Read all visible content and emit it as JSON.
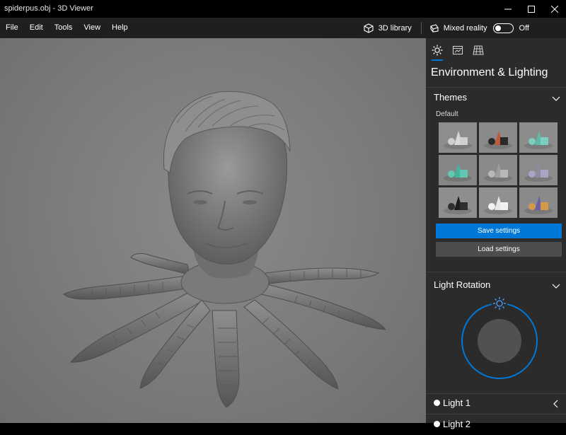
{
  "window": {
    "title": "spiderpus.obj - 3D Viewer",
    "controls": {
      "minimize": "—",
      "maximize": "☐",
      "close": "✕"
    }
  },
  "menu": {
    "items": [
      "File",
      "Edit",
      "Tools",
      "View",
      "Help"
    ],
    "library_label": "3D library",
    "mixed_reality_label": "Mixed reality",
    "toggle_state": "Off"
  },
  "panel": {
    "tabs": [
      "sun-icon",
      "stats-icon",
      "grid-icon"
    ],
    "title": "Environment & Lighting",
    "themes": {
      "heading": "Themes",
      "sublabel": "Default",
      "tiles": [
        {
          "bg": "#8d8d8d",
          "a": "#d9d9d9",
          "b": "#cfcfcf",
          "selected": true
        },
        {
          "bg": "#8a8a8a",
          "a": "#c05a36",
          "b": "#2a2a2a",
          "selected": false
        },
        {
          "bg": "#8c8c8c",
          "a": "#5fb8a8",
          "b": "#7acfc0",
          "selected": false
        },
        {
          "bg": "#868686",
          "a": "#41b39f",
          "b": "#5fc7b4",
          "selected": false
        },
        {
          "bg": "#8a8a8a",
          "a": "#9e9e9e",
          "b": "#b8b8b8",
          "selected": false
        },
        {
          "bg": "#8b8b8b",
          "a": "#8f8ba3",
          "b": "#a9a4c2",
          "selected": false
        },
        {
          "bg": "#8e8e8e",
          "a": "#1c1c1c",
          "b": "#2e2e2e",
          "selected": false
        },
        {
          "bg": "#909090",
          "a": "#e8e8e8",
          "b": "#f2f2f2",
          "selected": false
        },
        {
          "bg": "#8a8a8a",
          "a": "#6a5fa8",
          "b": "#d49a4a",
          "selected": false
        }
      ],
      "save_label": "Save settings",
      "load_label": "Load settings"
    },
    "light_rotation": {
      "heading": "Light Rotation"
    },
    "lights": [
      {
        "label": "Light 1"
      },
      {
        "label": "Light 2"
      }
    ]
  },
  "colors": {
    "accent": "#0078d7",
    "panel_bg": "#2b2b2b",
    "menubar_bg": "#1f1f1f"
  }
}
